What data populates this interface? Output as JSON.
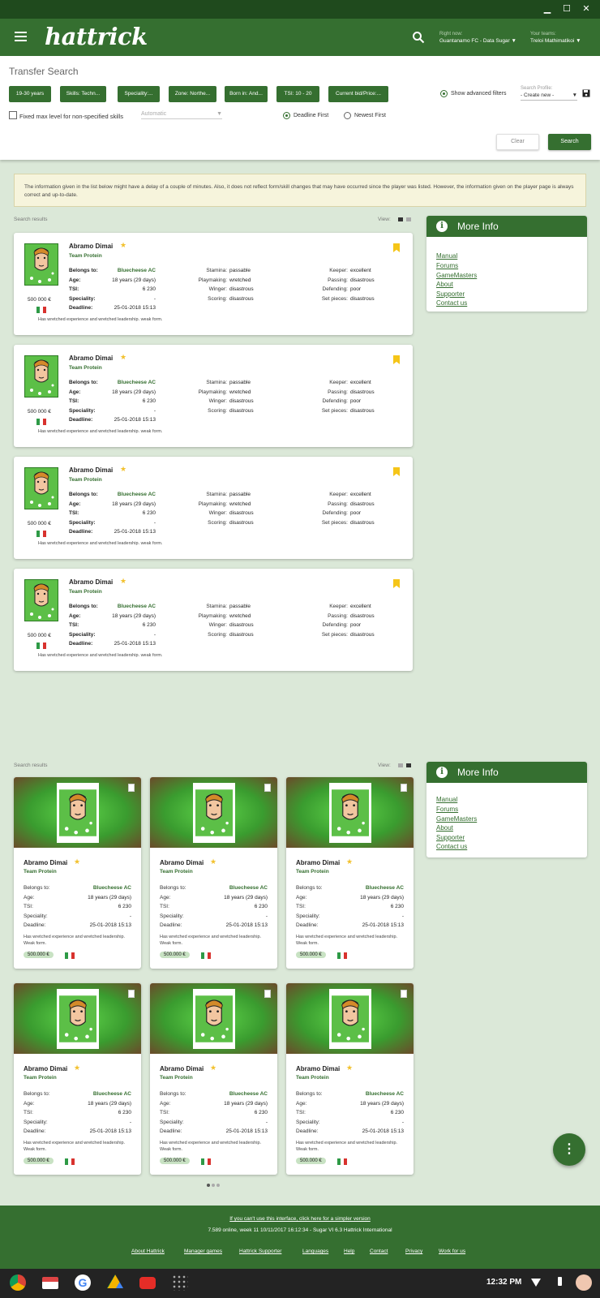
{
  "window": {
    "minimize": "▁",
    "maximize": "☐",
    "close": "✕"
  },
  "header": {
    "logo": "hattrick",
    "right_now_label": "Right now:",
    "right_now_value": "Guantanamo FC - Data Sugar",
    "your_teams_label": "Your teams:",
    "your_teams_value": "Treloi Mathimatikoi"
  },
  "filters": {
    "title": "Transfer Search",
    "chips": [
      "19-30 years",
      "Skills: Techn...",
      "Speciality:...",
      "Zone: Northe...",
      "Born in: And...",
      "TSI: 10 - 20",
      "Current bid/Price:..."
    ],
    "advanced": "Show advanced filters",
    "profile_label": "Search Profile:",
    "profile_value": "- Create new -",
    "fixed_max": "Fixed max level for non-specified skills",
    "automatic": "Automatic",
    "deadline_first": "Deadline First",
    "newest_first": "Newest First",
    "clear": "Clear",
    "search": "Search"
  },
  "notice": "The information given in the list below might have a delay of a couple of minutes. Also, it does not reflect form/skill changes that may have occurred since the player was listed. However, the information given on the player page is always correct and up-to-date.",
  "results_label": "Search results",
  "view_label": "View:",
  "player": {
    "name": "Abramo Dimai",
    "team": "Team Protein",
    "belongs_label": "Belongs to:",
    "belongs": "Bluecheese AC",
    "age_label": "Age:",
    "age": "18 years (29 days)",
    "tsi_label": "TSI:",
    "tsi": "6 230",
    "speciality_label": "Speciality:",
    "speciality": "-",
    "deadline_label": "Deadline:",
    "deadline": "25-01-2018 15:13",
    "price": "500 000 €",
    "price_pill": "500.000 €",
    "stamina_label": "Stamina:",
    "stamina": "passable",
    "playmaking_label": "Playmaking:",
    "playmaking": "wretched",
    "winger_label": "Winger:",
    "winger": "disastrous",
    "scoring_label": "Scoring:",
    "scoring": "disastrous",
    "keeper_label": "Keeper:",
    "keeper": "excellent",
    "passing_label": "Passing:",
    "passing": "disastrous",
    "defending_label": "Defending:",
    "defending": "poor",
    "setpieces_label": "Set pieces:",
    "setpieces": "disastrous",
    "note": "Has wretched experience and wretched leadership. weak form.",
    "note_grid": "Has wretched experience and wretched leadership. Weak form."
  },
  "more_info": {
    "title": "More Info",
    "links": [
      "Manual",
      "Forums",
      "GameMasters",
      "About",
      "Supporter",
      "Contact us"
    ]
  },
  "fab": "⋮",
  "footer": {
    "simple": "If you can't use this interface, click here for a simpler version",
    "status": "7.589 online, week 11 10/11/2017 16:12:34 - Sugar VI 6.3 Hattrick International",
    "links": [
      "About Hattrick",
      "Manager games",
      "Hattrick Supporter",
      "Languages",
      "Help",
      "Contact",
      "Privacy",
      "Work for us"
    ]
  },
  "taskbar": {
    "time": "12:32 PM"
  },
  "colors": {
    "brand": "#356f30",
    "bookmark": "#f5c518"
  }
}
